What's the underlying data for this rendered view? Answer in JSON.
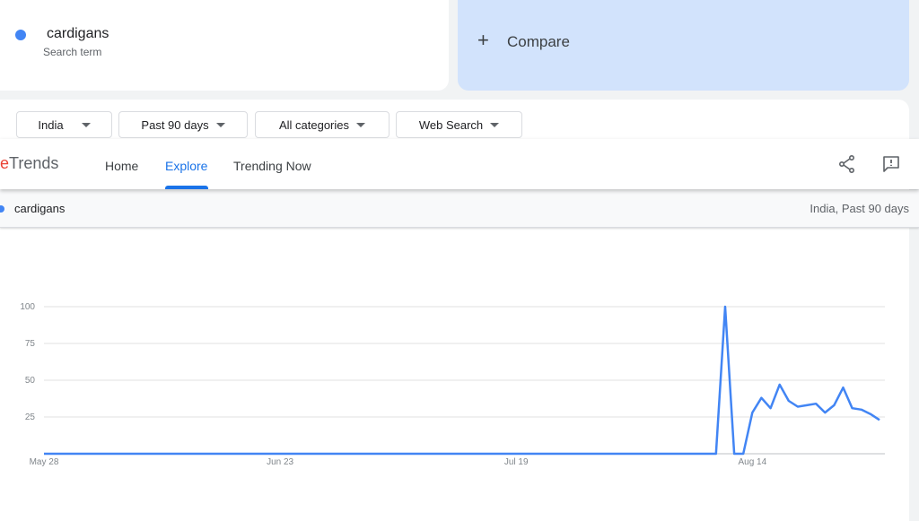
{
  "search_term": {
    "name": "cardigans",
    "subtitle": "Search term",
    "color": "#4285f4"
  },
  "compare": {
    "icon": "plus-icon",
    "label": "Compare"
  },
  "filters": [
    {
      "label": "India"
    },
    {
      "label": "Past 90 days"
    },
    {
      "label": "All categories"
    },
    {
      "label": "Web Search"
    }
  ],
  "topbar": {
    "brand_letter": "e",
    "brand": "Trends",
    "nav": [
      {
        "label": "Home"
      },
      {
        "label": "Explore",
        "active": true
      },
      {
        "label": "Trending Now"
      }
    ],
    "icons": [
      "share-icon",
      "feedback-icon"
    ]
  },
  "subbar": {
    "term": "cardigans",
    "meta": "India, Past 90 days"
  },
  "chart_data": {
    "type": "line",
    "y_ticks": [
      100,
      75,
      50,
      25
    ],
    "ylim": [
      0,
      100
    ],
    "x_tick_labels": [
      {
        "label": "May 28",
        "index": 0
      },
      {
        "label": "Jun 23",
        "index": 26
      },
      {
        "label": "Jul 19",
        "index": 52
      },
      {
        "label": "Aug 14",
        "index": 78
      }
    ],
    "series": [
      {
        "color": "#4285f4",
        "values": [
          0,
          0,
          0,
          0,
          0,
          0,
          0,
          0,
          0,
          0,
          0,
          0,
          0,
          0,
          0,
          0,
          0,
          0,
          0,
          0,
          0,
          0,
          0,
          0,
          0,
          0,
          0,
          0,
          0,
          0,
          0,
          0,
          0,
          0,
          0,
          0,
          0,
          0,
          0,
          0,
          0,
          0,
          0,
          0,
          0,
          0,
          0,
          0,
          0,
          0,
          0,
          0,
          0,
          0,
          0,
          0,
          0,
          0,
          0,
          0,
          0,
          0,
          0,
          0,
          0,
          0,
          0,
          0,
          0,
          0,
          0,
          0,
          0,
          0,
          0,
          100,
          0,
          0,
          28,
          38,
          31,
          47,
          36,
          32,
          33,
          34,
          28,
          33,
          45,
          31,
          30,
          27,
          23
        ]
      }
    ]
  }
}
